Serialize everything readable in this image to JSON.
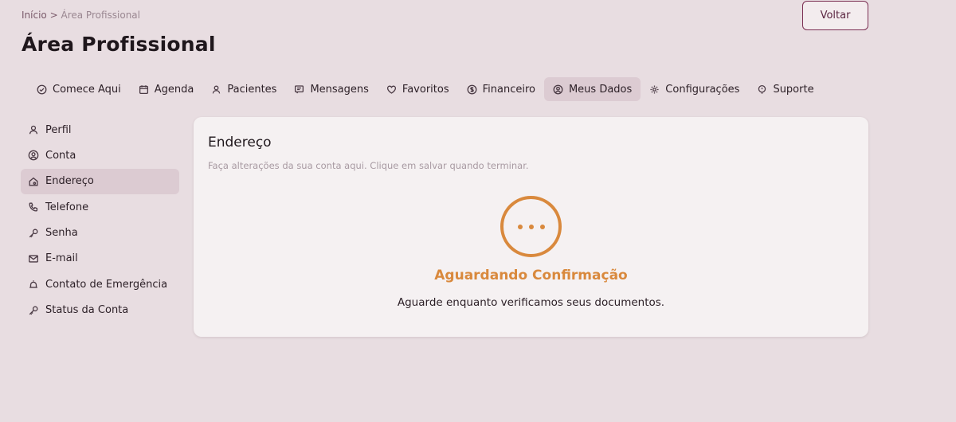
{
  "breadcrumb": {
    "home": "Início",
    "separator": ">",
    "current": "Área Profissional"
  },
  "page_title": "Área Profissional",
  "back_button": "Voltar",
  "tabs": [
    {
      "label": "Comece Aqui",
      "icon": "check-circle-icon"
    },
    {
      "label": "Agenda",
      "icon": "calendar-icon"
    },
    {
      "label": "Pacientes",
      "icon": "user-icon"
    },
    {
      "label": "Mensagens",
      "icon": "message-icon"
    },
    {
      "label": "Favoritos",
      "icon": "heart-icon"
    },
    {
      "label": "Financeiro",
      "icon": "dollar-icon"
    },
    {
      "label": "Meus Dados",
      "icon": "user-circle-icon",
      "active": true
    },
    {
      "label": "Configurações",
      "icon": "gear-icon"
    },
    {
      "label": "Suporte",
      "icon": "help-icon"
    }
  ],
  "sidebar": [
    {
      "label": "Perfil",
      "icon": "user-icon"
    },
    {
      "label": "Conta",
      "icon": "user-circle-icon"
    },
    {
      "label": "Endereço",
      "icon": "home-icon",
      "active": true
    },
    {
      "label": "Telefone",
      "icon": "phone-icon"
    },
    {
      "label": "Senha",
      "icon": "key-icon"
    },
    {
      "label": "E-mail",
      "icon": "mail-icon"
    },
    {
      "label": "Contato de Emergência",
      "icon": "alarm-icon"
    },
    {
      "label": "Status da Conta",
      "icon": "key-icon"
    }
  ],
  "card": {
    "title": "Endereço",
    "description": "Faça alterações da sua conta aqui. Clique em salvar quando terminar.",
    "status_title": "Aguardando Confirmação",
    "status_message": "Aguarde enquanto verificamos seus documentos."
  },
  "colors": {
    "accent": "#d9893d",
    "brand": "#7a2e52",
    "active_bg": "#dccbd2"
  }
}
